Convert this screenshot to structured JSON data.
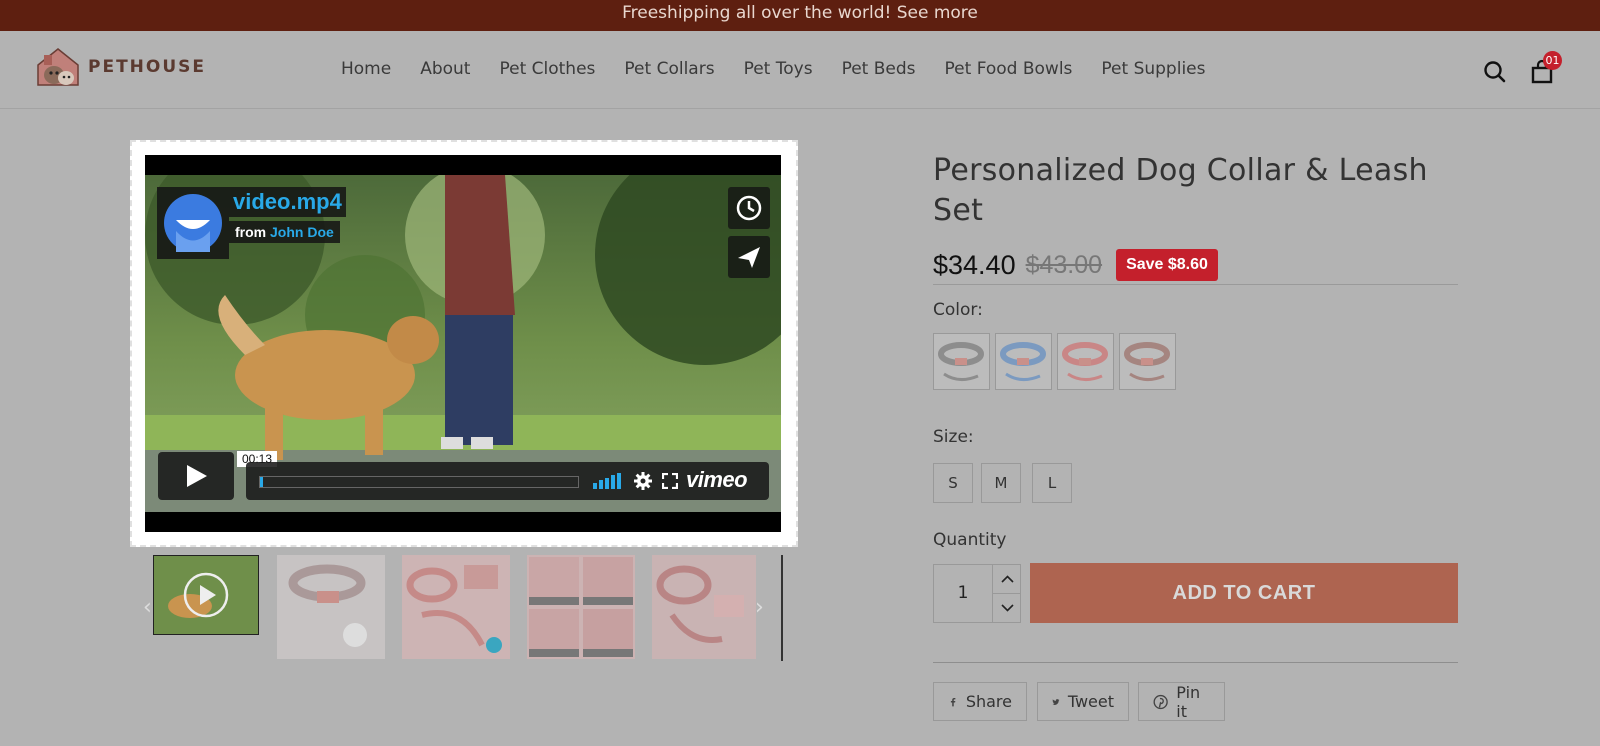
{
  "announcement": "Freeshipping all over the world! See more",
  "brand": {
    "name": "PETHOUSE"
  },
  "nav": [
    "Home",
    "About",
    "Pet Clothes",
    "Pet Collars",
    "Pet Toys",
    "Pet Beds",
    "Pet Food Bowls",
    "Pet Supplies"
  ],
  "cart": {
    "count": "01"
  },
  "video": {
    "title": "video.mp4",
    "from_prefix": "from",
    "author": "John Doe",
    "timecode": "00:13",
    "progress_fraction": 0.01,
    "brand": "vimeo"
  },
  "product": {
    "title": "Personalized Dog Collar & Leash Set",
    "price": "$34.40",
    "compare_price": "$43.00",
    "save_label": "Save $8.60",
    "color_label": "Color:",
    "colors": [
      "grey",
      "blue",
      "pink",
      "brown"
    ],
    "size_label": "Size:",
    "sizes": [
      "S",
      "M",
      "L"
    ],
    "quantity_label": "Quantity",
    "quantity": "1",
    "add_to_cart": "ADD TO CART",
    "share": [
      {
        "label": "Share",
        "icon": "facebook-icon"
      },
      {
        "label": "Tweet",
        "icon": "twitter-icon"
      },
      {
        "label": "Pin it",
        "icon": "pinterest-icon"
      }
    ]
  },
  "colors": {
    "topbar": "#5e1f10",
    "accent": "#ae6450",
    "badge": "#c4202c",
    "video_link": "#29a9e8"
  }
}
